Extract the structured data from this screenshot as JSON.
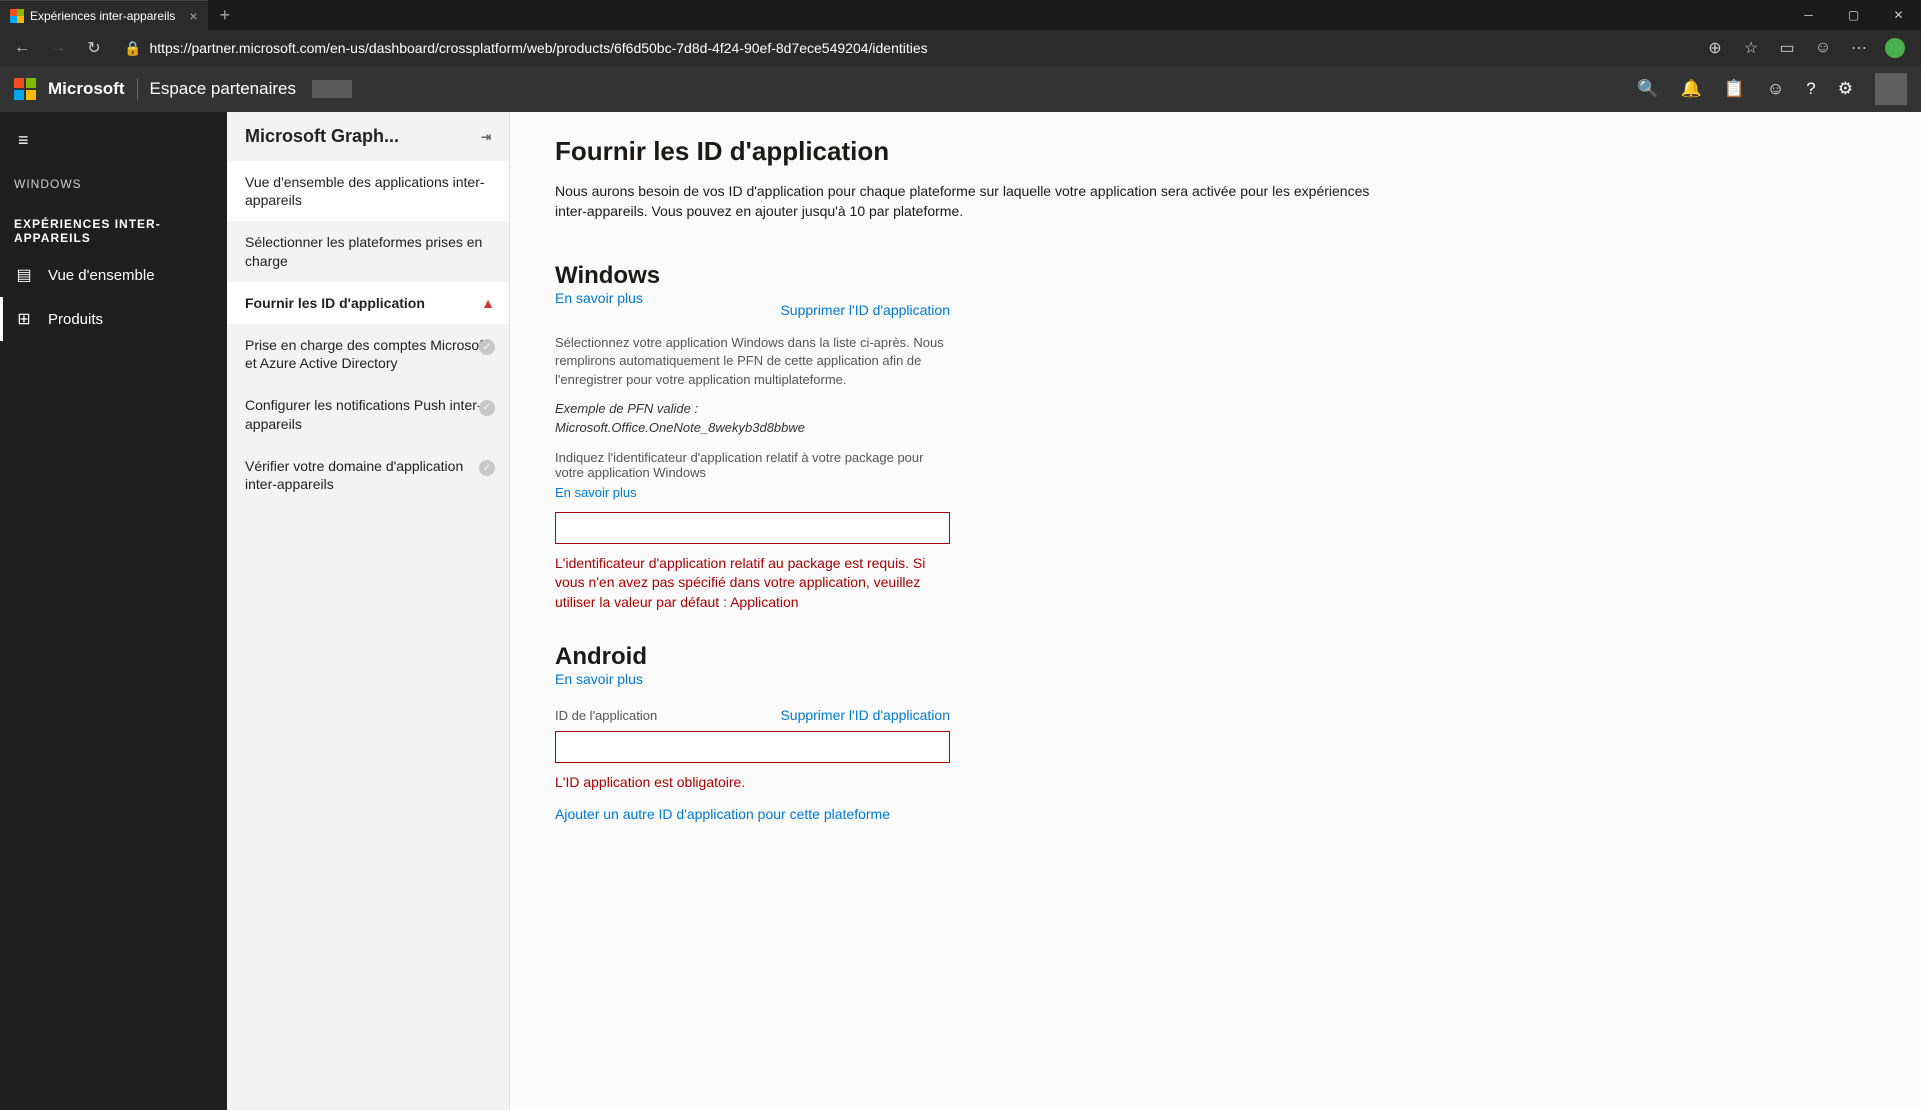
{
  "browser": {
    "tab_title": "Expériences inter-appareils",
    "url": "https://partner.microsoft.com/en-us/dashboard/crossplatform/web/products/6f6d50bc-7d8d-4f24-90ef-8d7ece549204/identities"
  },
  "header": {
    "brand": "Microsoft",
    "portal": "Espace partenaires"
  },
  "sidebar_left": {
    "section1": "WINDOWS",
    "section2": "EXPÉRIENCES INTER-APPAREILS",
    "items": [
      {
        "label": "Vue d'ensemble"
      },
      {
        "label": "Produits"
      }
    ]
  },
  "sidebar_mid": {
    "title": "Microsoft Graph...",
    "items": [
      {
        "label": "Vue d'ensemble des applications inter-appareils"
      },
      {
        "label": "Sélectionner les plateformes prises en charge"
      },
      {
        "label": "Fournir les ID d'application"
      },
      {
        "label": "Prise en charge des comptes Microsoft et Azure Active Directory"
      },
      {
        "label": "Configurer les notifications Push inter-appareils"
      },
      {
        "label": "Vérifier votre domaine d'application inter-appareils"
      }
    ]
  },
  "content": {
    "title": "Fournir les ID d'application",
    "intro": "Nous aurons besoin de vos ID d'application pour chaque plateforme sur laquelle votre application sera activée pour les expériences inter-appareils. Vous pouvez en ajouter jusqu'à 10 par plateforme.",
    "learn_more": "En savoir plus",
    "remove_app": "Supprimer l'ID d'application",
    "add_another": "Ajouter un autre ID d'application pour cette plateforme",
    "windows": {
      "heading": "Windows",
      "help1": "Sélectionnez votre application Windows dans la liste ci-après. Nous remplirons automatiquement le PFN de cette application afin de l'enregistrer pour votre application multiplateforme.",
      "example": "Exemple de PFN valide : Microsoft.Office.OneNote_8wekyb3d8bbwe",
      "field_label": "Indiquez l'identificateur d'application relatif à votre package pour votre application Windows",
      "error": "L'identificateur d'application relatif au package est requis. Si vous n'en avez pas spécifié dans votre application, veuillez utiliser la valeur par défaut : Application"
    },
    "android": {
      "heading": "Android",
      "field_label": "ID de l'application",
      "error": "L'ID application est obligatoire."
    }
  }
}
